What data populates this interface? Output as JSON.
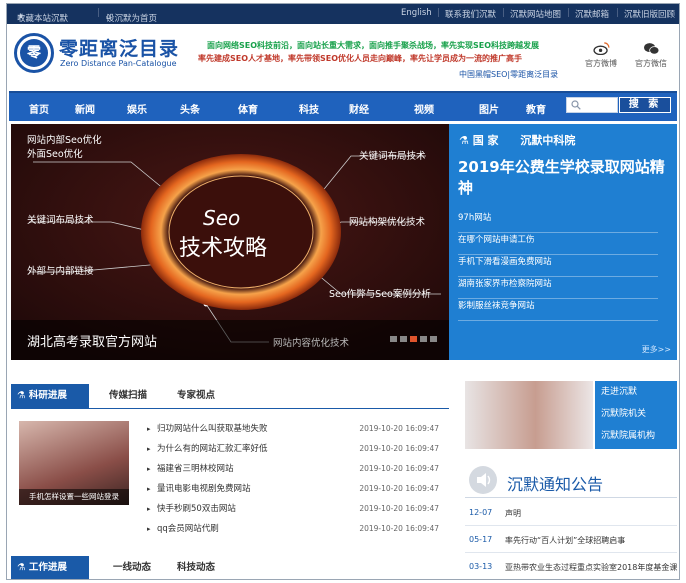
{
  "topbar": {
    "favorite": "收藏本站沉默",
    "set_home": "设沉默为首页",
    "english": "English",
    "contact": "联系我们沉默",
    "sitemap": "沉默网站地图",
    "mail": "沉默邮箱",
    "old_site": "沉默旧版回顾"
  },
  "header": {
    "logo_char": "零",
    "site_name": "零距离泛目录",
    "site_subtitle": "Zero Distance Pan-Catalogue",
    "slogan_line1": "面向网络SEO科技前沿，面向站长重大需求，面向推手聚杀战场，率先实现SEO科技跨越发展",
    "slogan_line2": "率先建成SEO人才基地，率先带领SEO优化人员走向巅峰，率先让学员成为一流的推广高手",
    "slogan_line3": "中国黑帽SEO|零距离泛目录",
    "weibo_label": "官方微博",
    "wechat_label": "官方微信"
  },
  "nav": {
    "items": [
      "首页",
      "新闻",
      "娱乐",
      "头条",
      "体育",
      "科技",
      "财经",
      "视频",
      "图片",
      "教育"
    ],
    "search_button": "搜 索"
  },
  "hero": {
    "center_line1": "Seo",
    "center_line2": "技术攻略",
    "labels": [
      "网站内部Seo优化",
      "外面Seo优化",
      "关键词布局技术",
      "关键词布局技术",
      "网站构架优化技术",
      "外部与内部链接",
      "Seo作弊与Seo案例分析",
      "网站内容优化技术"
    ],
    "caption": "湖北高考录取官方网站"
  },
  "blue_panel": {
    "tab1": "国 家",
    "tab2": "沉默中科院",
    "headline": "2019年公费生学校录取网站精神",
    "links": [
      "97h网站",
      "在哪个网站申请工伤",
      "手机下滑看漫画免费网站",
      "湖南张家界市检察院网站",
      "影制服丝袜竞争网站"
    ],
    "more": "更多>>"
  },
  "research": {
    "tabs": [
      "科研进展",
      "传媒扫描",
      "专家视点"
    ],
    "thumb_caption": "手机怎样设置一些网站登录",
    "items": [
      {
        "title": "归功网站什么叫获取基地失败",
        "date": "2019-10-20 16:09:47"
      },
      {
        "title": "为什么有的网站汇款汇率好低",
        "date": "2019-10-20 16:09:47"
      },
      {
        "title": "福建省三明林校网站",
        "date": "2019-10-20 16:09:47"
      },
      {
        "title": "量讯电影电视剧免费网站",
        "date": "2019-10-20 16:09:47"
      },
      {
        "title": "快手秒刷50双击网站",
        "date": "2019-10-20 16:09:47"
      },
      {
        "title": "qq会员网站代刷",
        "date": "2019-10-20 16:09:47"
      }
    ]
  },
  "side_links": [
    "走进沉默",
    "沉默院机关",
    "沉默院属机构"
  ],
  "notice": {
    "title": "沉默通知公告",
    "items": [
      {
        "date": "12-07",
        "text": "声明"
      },
      {
        "date": "05-17",
        "text": "率先行动“百人计划”全球招聘启事"
      },
      {
        "date": "03-13",
        "text": "亚热带农业生态过程重点实验室2018年度基金课"
      }
    ]
  },
  "work": {
    "tabs": [
      "工作进展",
      "一线动态",
      "科技动态"
    ]
  },
  "colors": {
    "topbar": "#15325f",
    "brand_blue": "#1a53a6",
    "nav_blue": "#1f62bd",
    "panel_blue": "#1f7fd2",
    "hero_dark": "#2c0f10",
    "slogan_green": "#18a14b",
    "slogan_red": "#c0392b",
    "dot_active": "#e0542c"
  },
  "icons": {
    "star": "star-icon",
    "home": "home-icon",
    "weibo": "weibo-icon",
    "wechat": "wechat-icon",
    "search": "search-icon",
    "flask": "flask-icon",
    "speaker": "speaker-icon"
  }
}
